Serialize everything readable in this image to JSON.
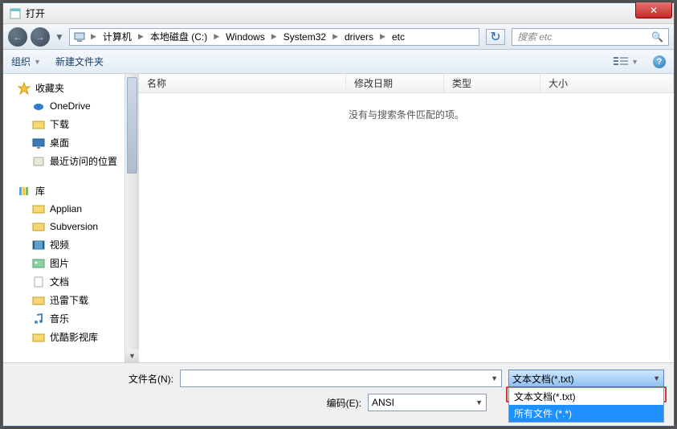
{
  "title": "打开",
  "breadcrumbs": [
    "计算机",
    "本地磁盘 (C:)",
    "Windows",
    "System32",
    "drivers",
    "etc"
  ],
  "search_placeholder": "搜索 etc",
  "toolbar": {
    "organize": "组织",
    "newfolder": "新建文件夹"
  },
  "columns": {
    "name": "名称",
    "modified": "修改日期",
    "type": "类型",
    "size": "大小"
  },
  "empty_msg": "没有与搜索条件匹配的项。",
  "sidebar": {
    "fav": {
      "label": "收藏夹",
      "items": [
        "OneDrive",
        "下载",
        "桌面",
        "最近访问的位置"
      ]
    },
    "lib": {
      "label": "库",
      "items": [
        "Applian",
        "Subversion",
        "视频",
        "图片",
        "文档",
        "迅雷下载",
        "音乐",
        "优酷影视库"
      ]
    }
  },
  "bottom": {
    "filename_label": "文件名(N):",
    "encoding_label": "编码(E):",
    "encoding_value": "ANSI",
    "filetype_value": "文本文档(*.txt)",
    "options": [
      "文本文档(*.txt)",
      "所有文件 (*.*)"
    ]
  }
}
